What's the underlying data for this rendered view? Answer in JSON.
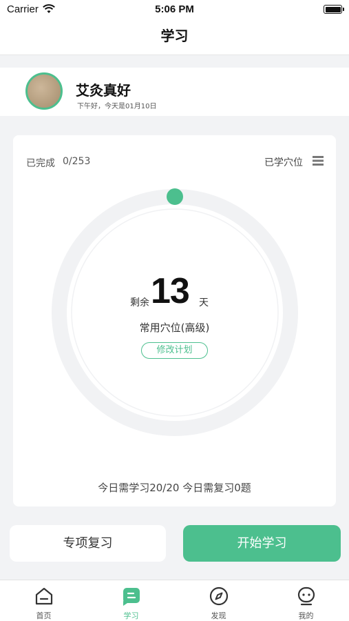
{
  "status_bar": {
    "carrier": "Carrier",
    "time": "5:06 PM"
  },
  "nav": {
    "title": "学习"
  },
  "profile": {
    "name": "艾灸真好",
    "greeting": "下午好，今天是01月10日"
  },
  "progress_card": {
    "completed_label": "已完成",
    "completed_value": "0/253",
    "completed_count": 0,
    "completed_total": 253,
    "learned_label": "已学穴位",
    "remaining_prefix": "剩余",
    "remaining_days": "13",
    "remaining_unit": "天",
    "course_name": "常用穴位(高级)",
    "edit_plan_label": "修改计划",
    "daily_summary": "今日需学习20/20   今日需复习0题"
  },
  "actions": {
    "review_label": "专项复习",
    "start_label": "开始学习"
  },
  "tab_bar": {
    "items": [
      {
        "label": "首页",
        "icon": "home-icon",
        "active": false
      },
      {
        "label": "学习",
        "icon": "study-icon",
        "active": true
      },
      {
        "label": "发现",
        "icon": "compass-icon",
        "active": false
      },
      {
        "label": "我的",
        "icon": "profile-icon",
        "active": false
      }
    ]
  },
  "colors": {
    "accent": "#4cbf8e",
    "background": "#f2f3f5",
    "ring_track": "#f1f2f4"
  }
}
